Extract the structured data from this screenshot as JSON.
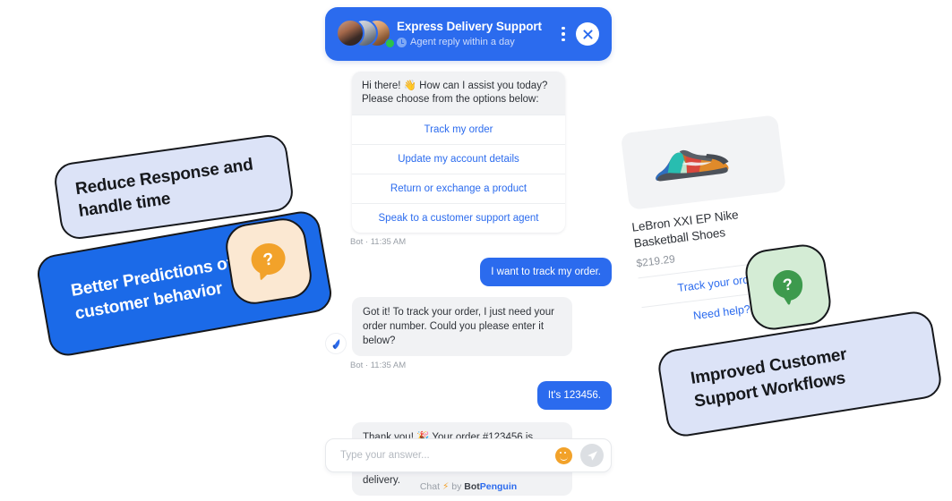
{
  "widget": {
    "header": {
      "title": "Express Delivery Support",
      "subtitle": "Agent reply within a day",
      "clock_icon": "clock-icon",
      "menu_icon": "kebab-menu-icon",
      "close_icon": "close-icon",
      "status": "online"
    },
    "colors": {
      "brand_blue": "#2b6bee",
      "card_blue": "#1b6ae8",
      "light_blue": "#dce3f7",
      "bot_bubble": "#f1f2f4",
      "orange": "#f2a22a",
      "green": "#3d9a4d",
      "online_green": "#2bc24a"
    },
    "messages": [
      {
        "type": "options",
        "intro": "Hi there! 👋 How can I assist you today? Please choose from the options below:",
        "options": [
          "Track my order",
          "Update my account details",
          "Return or exchange a product",
          "Speak to a customer support agent"
        ],
        "stamp": "Bot · 11:35 AM"
      },
      {
        "type": "user",
        "text": "I want to track my order."
      },
      {
        "type": "bot",
        "text": "Got it! To track your order, I just need your order number. Could you please enter it below?",
        "stamp": "Bot · 11:35 AM"
      },
      {
        "type": "user",
        "text": "It's 123456."
      },
      {
        "type": "bot",
        "text": "Thank you! 🎉 Your order #123456 is currently in transit and will arrive in 3 days. You'll receive a notification once it's out for delivery."
      }
    ],
    "input": {
      "placeholder": "Type your answer...",
      "value": "",
      "emoji_icon": "smiley-icon",
      "send_icon": "send-paper-plane-icon"
    },
    "footer": {
      "prefix": "Chat",
      "bolt": "⚡",
      "by": "by",
      "brand_bold": "Bot",
      "brand_accent": "Penguin"
    }
  },
  "callouts": [
    {
      "text": "Reduce Response and handle time",
      "style": "light"
    },
    {
      "text": "Better Predictions of customer behavior",
      "style": "solid"
    },
    {
      "text": "Improved Customer Support Workflows",
      "style": "light"
    }
  ],
  "badges": [
    {
      "name": "question-bubble-badge-orange",
      "glyph": "?",
      "tone": "orange"
    },
    {
      "name": "question-bubble-badge-green",
      "glyph": "?",
      "tone": "green"
    }
  ],
  "product": {
    "image_alt": "lebron-basketball-shoe-image",
    "title": "LeBron XXI EP Nike Basketball Shoes",
    "price": "$219.29",
    "links": [
      "Track your order",
      "Need help?"
    ]
  }
}
